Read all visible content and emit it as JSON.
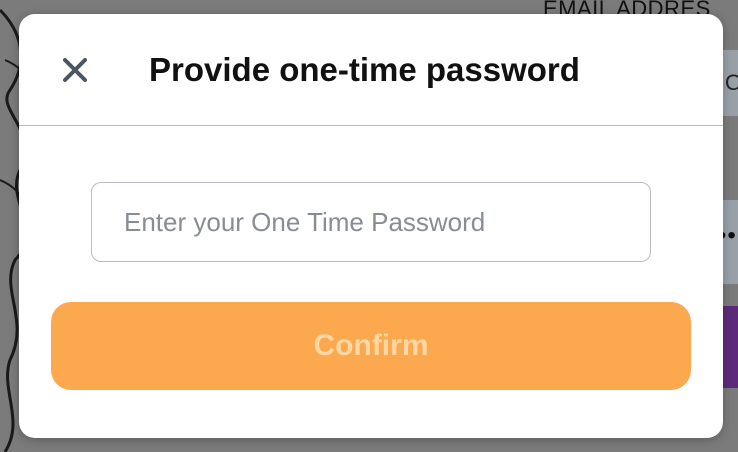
{
  "background": {
    "email_label": "EMAIL ADDRES",
    "input_fragment": "O",
    "password_dots": "••"
  },
  "modal": {
    "title": "Provide one-time password",
    "close_icon": "close-icon",
    "otp_input": {
      "value": "",
      "placeholder": "Enter your One Time Password"
    },
    "confirm_label": "Confirm"
  },
  "colors": {
    "accent": "#fca84e",
    "confirm_text": "#ffd7a2",
    "divider": "#b7bcc3",
    "close_icon": "#4a5563"
  }
}
